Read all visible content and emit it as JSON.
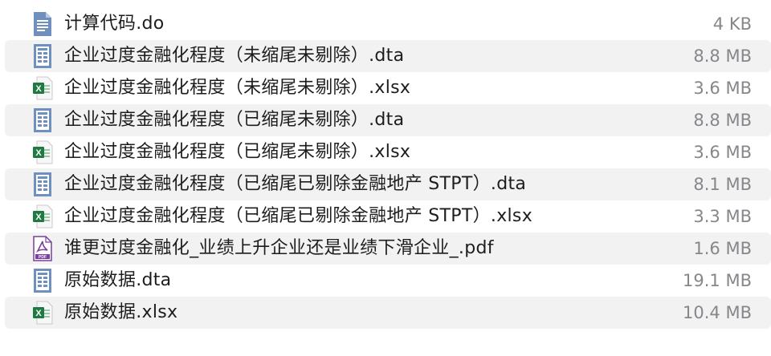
{
  "files": [
    {
      "name": "计算代码.do",
      "size": "4 KB",
      "icon": "text-document-icon"
    },
    {
      "name": "企业过度金融化程度（未缩尾未剔除）.dta",
      "size": "8.8 MB",
      "icon": "stata-data-icon"
    },
    {
      "name": "企业过度金融化程度（未缩尾未剔除）.xlsx",
      "size": "3.6 MB",
      "icon": "excel-icon"
    },
    {
      "name": "企业过度金融化程度（已缩尾未剔除）.dta",
      "size": "8.8 MB",
      "icon": "stata-data-icon"
    },
    {
      "name": "企业过度金融化程度（已缩尾未剔除）.xlsx",
      "size": "3.6 MB",
      "icon": "excel-icon"
    },
    {
      "name": "企业过度金融化程度（已缩尾已剔除金融地产 STPT）.dta",
      "size": "8.1 MB",
      "icon": "stata-data-icon"
    },
    {
      "name": "企业过度金融化程度（已缩尾已剔除金融地产 STPT）.xlsx",
      "size": "3.3 MB",
      "icon": "excel-icon"
    },
    {
      "name": "谁更过度金融化_业绩上升企业还是业绩下滑企业_.pdf",
      "size": "1.6 MB",
      "icon": "pdf-icon"
    },
    {
      "name": "原始数据.dta",
      "size": "19.1 MB",
      "icon": "stata-data-icon"
    },
    {
      "name": "原始数据.xlsx",
      "size": "10.4 MB",
      "icon": "excel-icon"
    }
  ],
  "colors": {
    "row_alt": "#f2f2f2",
    "doc_blue": "#5a7fb0",
    "excel_green": "#1f7a42",
    "pdf_purple": "#7b3fa0"
  }
}
